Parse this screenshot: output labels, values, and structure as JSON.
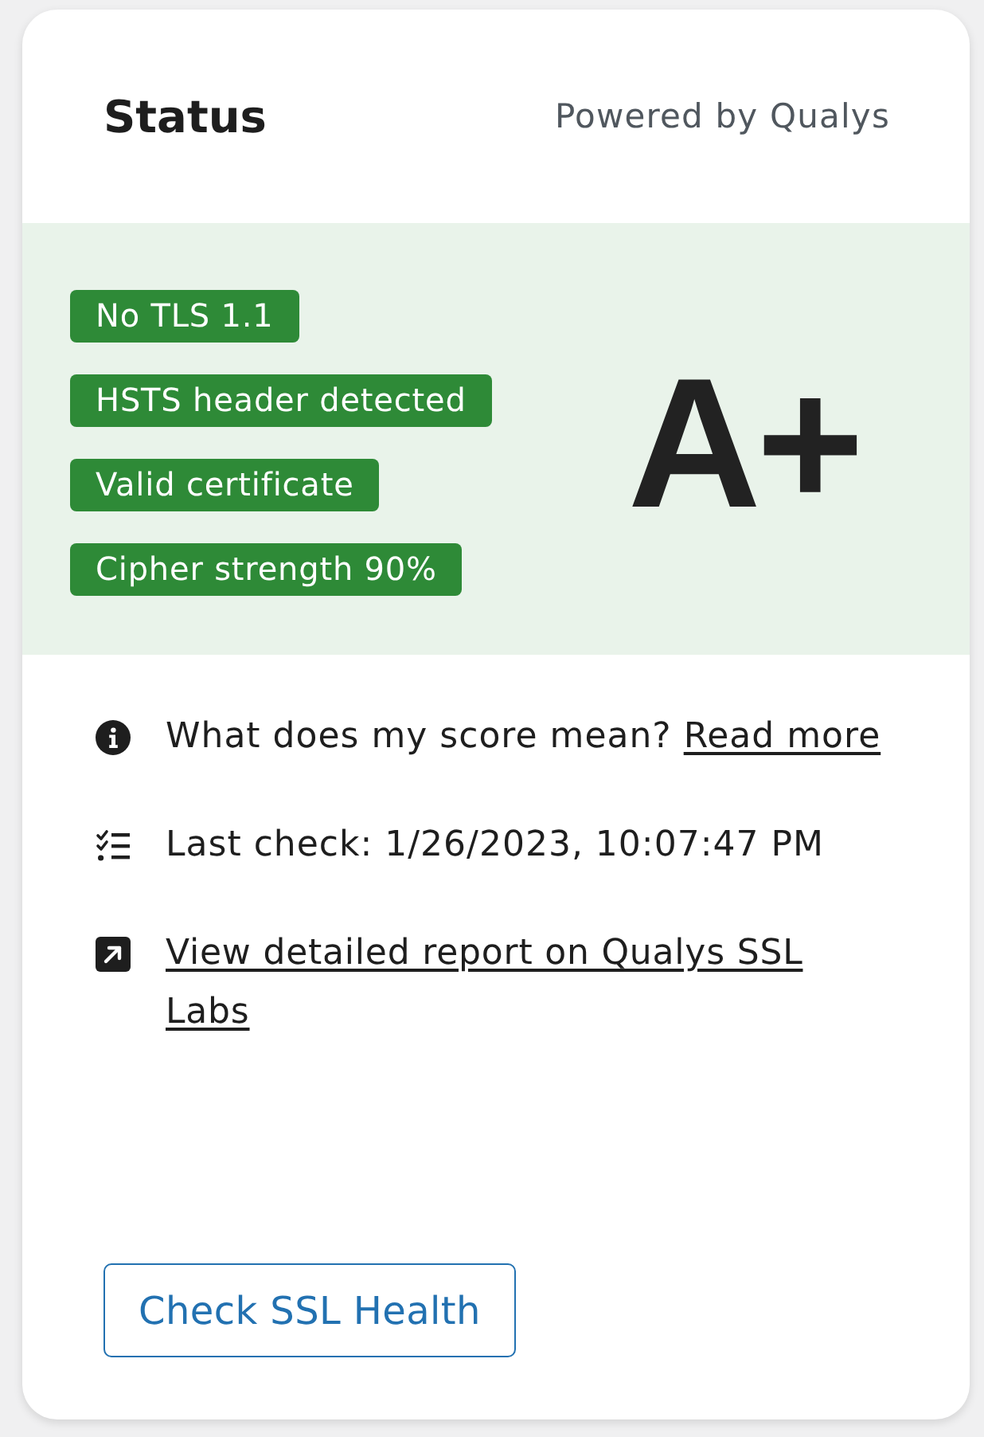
{
  "header": {
    "title": "Status",
    "provider": "Powered by Qualys"
  },
  "grade_panel": {
    "badges": [
      "No TLS 1.1",
      "HSTS header detected",
      "Valid certificate",
      "Cipher strength 90%"
    ],
    "grade": "A+"
  },
  "details": [
    {
      "kind": "info",
      "text": "What does my score mean?",
      "link": "Read more"
    },
    {
      "kind": "checklist",
      "text": "Last check: 1/26/2023, 10:07:47 PM"
    },
    {
      "kind": "external",
      "link": "View detailed report on Qualys SSL Labs"
    }
  ],
  "action_button": {
    "label": "Check SSL Health"
  }
}
